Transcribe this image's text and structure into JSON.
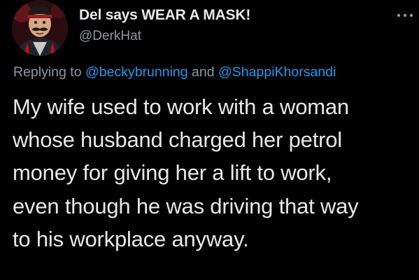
{
  "tweet": {
    "display_name": "Del says WEAR A MASK!",
    "handle": "@DerkHat",
    "avatar_icon": "profile-avatar-masked-face",
    "more_icon": "more-horizontal-icon",
    "reply": {
      "prefix": "Replying to",
      "mention_1": "@beckybrunning",
      "conjunction": "and",
      "mention_2": "@ShappiKhorsandi"
    },
    "body_lines": [
      "My wife used to work with a woman",
      "whose husband charged her petrol",
      "money for giving her a lift to work,",
      "even though he was driving that way",
      "to his workplace anyway."
    ]
  },
  "colors": {
    "background": "#000000",
    "primary_text": "#e7e9ea",
    "secondary_text": "#8b98a5",
    "link": "#1d9bf0"
  }
}
